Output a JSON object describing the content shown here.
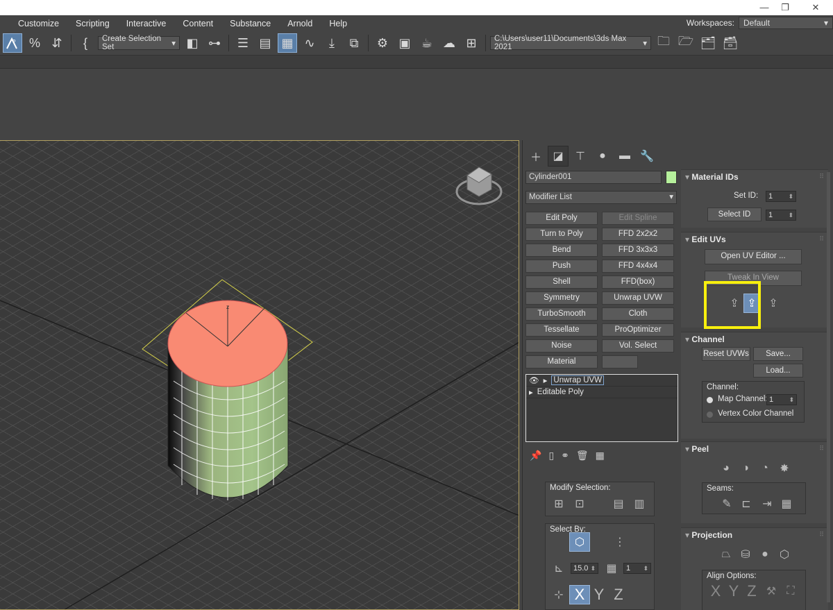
{
  "window": {
    "minimize": "—",
    "restore": "❐",
    "close": "✕"
  },
  "menu": [
    "Customize",
    "Scripting",
    "Interactive",
    "Content",
    "Substance",
    "Arnold",
    "Help"
  ],
  "workspace": {
    "label": "Workspaces:",
    "value": "Default"
  },
  "toolbar": {
    "selection_set": "Create Selection Set",
    "project_path": "C:\\Users\\user11\\Documents\\3ds Max 2021"
  },
  "object": {
    "name": "Cylinder001",
    "color": "#b6f09c"
  },
  "modifier_list": {
    "label": "Modifier List"
  },
  "modifier_buttons": [
    {
      "label": "Edit Poly",
      "enabled": true
    },
    {
      "label": "Edit Spline",
      "enabled": false
    },
    {
      "label": "Turn to Poly",
      "enabled": true
    },
    {
      "label": "FFD 2x2x2",
      "enabled": true
    },
    {
      "label": "Bend",
      "enabled": true
    },
    {
      "label": "FFD 3x3x3",
      "enabled": true
    },
    {
      "label": "Push",
      "enabled": true
    },
    {
      "label": "FFD 4x4x4",
      "enabled": true
    },
    {
      "label": "Shell",
      "enabled": true
    },
    {
      "label": "FFD(box)",
      "enabled": true
    },
    {
      "label": "Symmetry",
      "enabled": true
    },
    {
      "label": "Unwrap UVW",
      "enabled": true
    },
    {
      "label": "TurboSmooth",
      "enabled": true
    },
    {
      "label": "Cloth",
      "enabled": true
    },
    {
      "label": "Tessellate",
      "enabled": true
    },
    {
      "label": "ProOptimizer",
      "enabled": true
    },
    {
      "label": "Noise",
      "enabled": true
    },
    {
      "label": "Vol. Select",
      "enabled": true
    },
    {
      "label": "Material",
      "enabled": true
    },
    {
      "label": "",
      "enabled": true
    }
  ],
  "stack": [
    {
      "label": "Unwrap UVW",
      "selected": true
    },
    {
      "label": "Editable Poly",
      "selected": false
    }
  ],
  "modify_selection": {
    "label": "Modify Selection:"
  },
  "select_by": {
    "label": "Select By:",
    "angle": "15.0",
    "count": "1",
    "x": "X",
    "y": "Y",
    "z": "Z"
  },
  "material_ids": {
    "title": "Material IDs",
    "set_id_label": "Set ID:",
    "set_id": "1",
    "select_id_label": "Select ID",
    "select_id": "1"
  },
  "edit_uvs": {
    "title": "Edit UVs",
    "open_editor": "Open UV Editor ...",
    "tweak": "Tweak In View"
  },
  "channel": {
    "title": "Channel",
    "reset": "Reset UVWs",
    "save": "Save...",
    "load": "Load...",
    "group": "Channel:",
    "map_channel": "Map Channel:",
    "map_value": "1",
    "vertex_color": "Vertex Color Channel"
  },
  "peel": {
    "title": "Peel",
    "seams": "Seams:"
  },
  "projection": {
    "title": "Projection",
    "align": "Align Options:",
    "x": "X",
    "y": "Y",
    "z": "Z"
  }
}
